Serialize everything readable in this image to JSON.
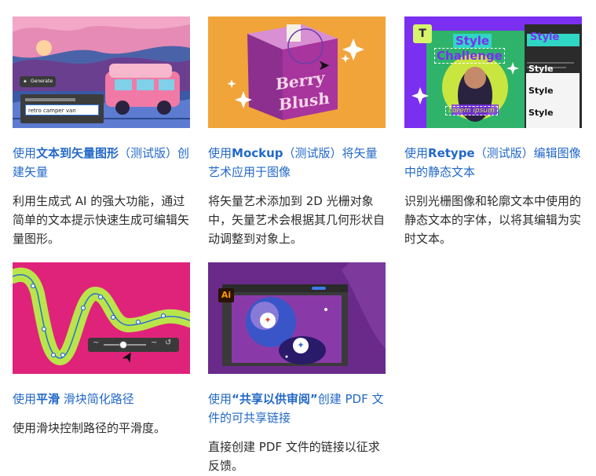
{
  "cards": [
    {
      "title_pre": "使用",
      "title_bold": "文本到矢量图形",
      "title_post": "（测试版）创建矢量",
      "desc": "利用生成式 AI 的强大功能，通过简单的文本提示快速生成可编辑矢量图形。",
      "thumb": {
        "generate_label": "Generate",
        "prompt_value": "retro camper van"
      }
    },
    {
      "title_pre": "使用",
      "title_bold": "Mockup",
      "title_post": "（测试版）将矢量艺术应用于图像",
      "desc": "将矢量艺术添加到 2D 光栅对象中，矢量艺术会根据其几何形状自动调整到对象上。",
      "thumb": {
        "box_line1": "Berry",
        "box_line2": "Blush"
      }
    },
    {
      "title_pre": "使用",
      "title_bold": "Retype",
      "title_post": "（测试版）编辑图像中的静态文本",
      "desc": "识别光栅图像和轮廓文本中使用的静态文本的字体，以将其编辑为实时文本。",
      "thumb": {
        "poster_line1": "Style",
        "poster_line2": "Challenge",
        "poster_sub": "Lorem ipsum",
        "panel_items": [
          "Style",
          "Style",
          "Style",
          "Style"
        ]
      }
    },
    {
      "title_pre": "使用",
      "title_bold": "平滑",
      "title_post": " 滑块简化路径",
      "desc": "使用滑块控制路径的平滑度。",
      "thumb": {}
    },
    {
      "title_pre": "使用",
      "title_bold": "“共享以供审阅”",
      "title_post": "创建 PDF 文件的可共享链接",
      "desc": "直接创建 PDF 文件的链接以征求反馈。",
      "thumb": {
        "ai_badge": "Ai"
      }
    }
  ],
  "colors": {
    "link_blue": "#2268c8",
    "text_dark": "#2c2c2c"
  }
}
